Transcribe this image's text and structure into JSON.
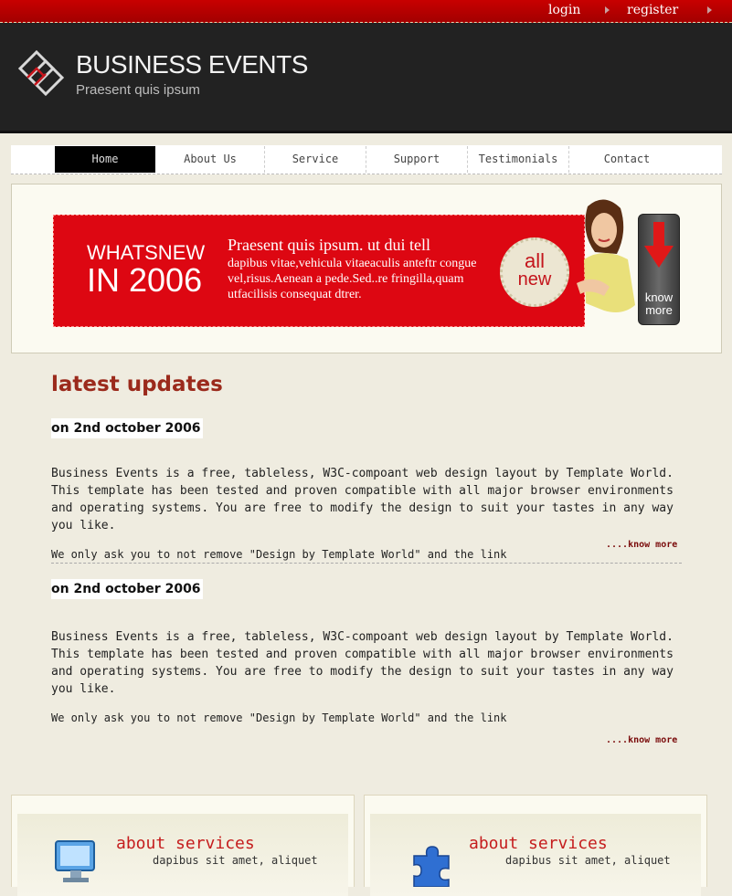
{
  "topbar": {
    "login": "login",
    "register": "register"
  },
  "header": {
    "title": "BUSINESS EVENTS",
    "subtitle": "Praesent quis ipsum"
  },
  "nav": {
    "items": [
      "Home",
      "About Us",
      "Service",
      "Support",
      "Testimonials",
      "Contact"
    ],
    "active": "Home"
  },
  "banner": {
    "whatsnew_line1": "WHATSNEW",
    "whatsnew_line2": "IN 2006",
    "title": "Praesent quis ipsum. ut dui tell",
    "text": "dapibus vitae,vehicula vitaeaculis anteftr congue vel,risus.Aenean a pede.Sed..re fringilla,quam utfacilisis consequat dtrer.",
    "seal_line1": "all",
    "seal_line2": "new",
    "know_line1": "know",
    "know_line2": "more"
  },
  "latest": {
    "title": "latest updates",
    "posts": [
      {
        "date": "on 2nd october 2006",
        "body": "Business Events is a free, tableless, W3C-compoant web design layout by Template World. This template has been tested and proven compatible with all major browser environments and operating systems. You are free to modify the design to suit your tastes in any way you like.",
        "note": "We only ask you to not remove \"Design by Template World\" and the link",
        "more": "....know more"
      },
      {
        "date": "on 2nd october 2006",
        "body": "Business Events is a free, tableless, W3C-compoant web design layout by Template World. This template has been tested and proven compatible with all major browser environments and operating systems. You are free to modify the design to suit your tastes in any way you like.",
        "note": "We only ask you to not remove \"Design by Template World\" and the link",
        "more": "....know more"
      }
    ]
  },
  "cards": [
    {
      "title": "about services",
      "subtitle": "dapibus sit amet, aliquet",
      "icon": "monitor-icon"
    },
    {
      "title": "about services",
      "subtitle": "dapibus sit amet, aliquet",
      "icon": "puzzle-icon"
    }
  ],
  "colors": {
    "brand_red": "#dd0712",
    "header_bg": "#222222",
    "title_red": "#9b2a1c",
    "page_bg": "#efece0"
  }
}
